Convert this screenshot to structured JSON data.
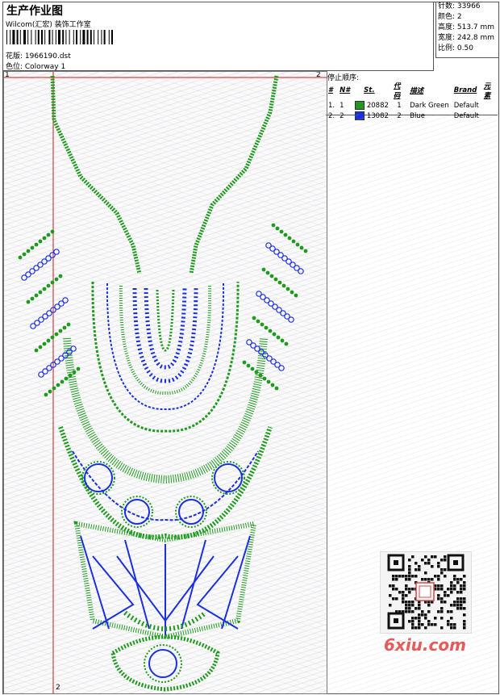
{
  "header": {
    "title": "生产作业图",
    "subtitle": "Wilcom(汇宏) 装饰工作室",
    "design_label": "花版: 1966190.dst",
    "colorway_label": "色位: Colorway 1"
  },
  "stats": [
    "针数: 33966",
    "颜色: 2",
    "高度: 513.7 mm",
    "宽度: 242.8 mm",
    "比例: 0.50"
  ],
  "stop_sequence": {
    "title": "停止顺序:",
    "columns": [
      "#",
      "N#",
      "St.",
      "代码",
      "描述",
      "Brand",
      "元素"
    ],
    "rows": [
      {
        "num": "1.",
        "n": "1",
        "color": "#1f9a1f",
        "stitches": "20882",
        "code": "1",
        "desc": "Dark Green",
        "brand": "Default",
        "element": ""
      },
      {
        "num": "2.",
        "n": "2",
        "color": "#1a2fe0",
        "stitches": "13082",
        "code": "2",
        "desc": "Blue",
        "brand": "Default",
        "element": ""
      }
    ]
  },
  "markers": {
    "top_left": "1",
    "top_right": "2",
    "bottom": "2"
  },
  "colors": {
    "green": "#1f9a1f",
    "blue": "#1a2fe0",
    "guide": "#d01515"
  },
  "watermark": "6xiu.com"
}
